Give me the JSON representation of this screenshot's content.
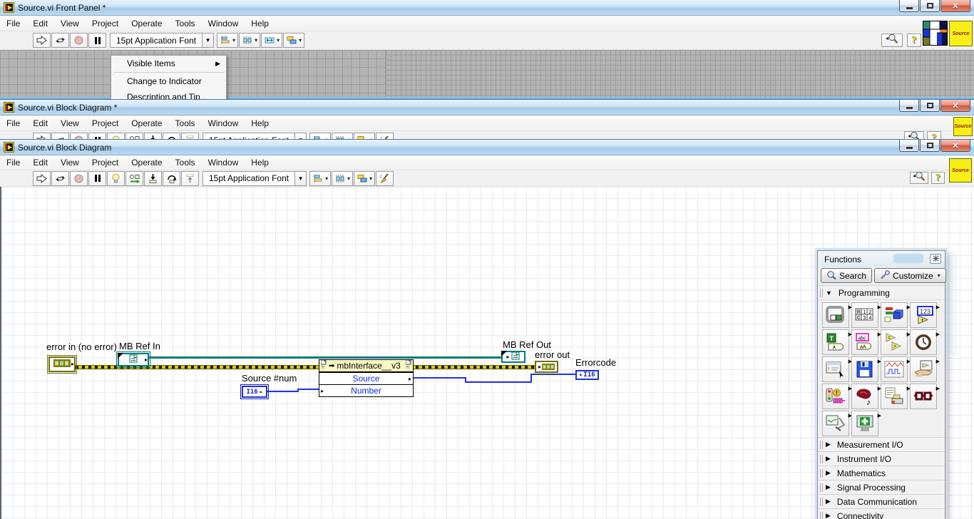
{
  "window_front_panel": {
    "title": "Source.vi Front Panel *"
  },
  "window_block_diagram_back": {
    "title": "Source.vi Block Diagram *"
  },
  "window_block_diagram": {
    "title": "Source.vi Block Diagram"
  },
  "menu_items": [
    "File",
    "Edit",
    "View",
    "Project",
    "Operate",
    "Tools",
    "Window",
    "Help"
  ],
  "font_selector": "15pt Application Font",
  "vi_badge": "Source",
  "glyphs": {
    "help_mark": "?"
  },
  "context_menu": {
    "items": [
      {
        "label": "Visible Items",
        "submenu": true
      },
      {
        "label": "Change to Indicator",
        "submenu": false
      },
      {
        "label": "Description and Tip...",
        "submenu": false
      }
    ]
  },
  "toolbars": {
    "front_panel_left": [
      {
        "icon": "run"
      },
      {
        "icon": "run-continuous"
      },
      {
        "icon": "abort"
      },
      {
        "icon": "pause"
      }
    ],
    "front_panel_right": [
      {
        "icon": "align-objects",
        "caret": true
      },
      {
        "icon": "distribute-objects",
        "caret": true
      },
      {
        "icon": "resize-objects",
        "caret": true
      },
      {
        "icon": "reorder",
        "caret": true
      }
    ],
    "block_diagram_left": [
      {
        "icon": "run"
      },
      {
        "icon": "run-continuous"
      },
      {
        "icon": "abort"
      },
      {
        "icon": "pause"
      },
      {
        "icon": "highlight-execution"
      },
      {
        "icon": "retain-wire-values"
      },
      {
        "icon": "step-into"
      },
      {
        "icon": "step-over"
      },
      {
        "icon": "step-out"
      }
    ],
    "block_diagram_right": [
      {
        "icon": "align-objects",
        "caret": true
      },
      {
        "icon": "distribute-objects",
        "caret": true
      },
      {
        "icon": "reorder",
        "caret": true
      },
      {
        "icon": "clean-up-diagram"
      }
    ]
  },
  "diagram": {
    "error_in_label": "error in (no error)",
    "mb_ref_in_label": "MB Ref In",
    "source_num_label": "Source #num",
    "mb_ref_out_label": "MB Ref Out",
    "error_out_label": "error out",
    "errorcode_label": "Errorcode",
    "i16_text": "I16",
    "node_title": "mbInterface__v3",
    "node_methods": [
      "Source",
      "Number"
    ]
  },
  "palette": {
    "title": "Functions",
    "search_label": "Search",
    "customize_label": "Customize",
    "open_category": "Programming",
    "icons": [
      "structures",
      "array",
      "cluster-class-variant",
      "numeric",
      "boolean",
      "string",
      "comparison",
      "timing",
      "dialog-user-interface",
      "file-io",
      "waveform",
      "application-control",
      "synchronization",
      "graphics-sound",
      "report-generation",
      "misc-functions",
      "measurement-probe",
      "addons"
    ],
    "icon_texts": {
      "numeric": "123",
      "boolean_true": "T",
      "boolean_and": "∧",
      "string_abc": "abc",
      "string_case": "aA",
      "comparison_eq": "=",
      "comparison_gt": ">",
      "sync_bang": "!",
      "music_note": "♪",
      "array_cells": [
        "1",
        "2",
        "3",
        "4"
      ],
      "array_rowcol": [
        "R",
        "C"
      ]
    },
    "categories": [
      "Measurement I/O",
      "Instrument I/O",
      "Mathematics",
      "Signal Processing",
      "Data Communication",
      "Connectivity"
    ]
  },
  "colors": {
    "titlebar_blue": "#a6cbe8",
    "error_wire_yellow": "#d8c821",
    "refnum_teal": "#057a7a",
    "numeric_blue": "#2233cc",
    "node_header_yellow": "#fcf8c6",
    "front_panel_gray": "#b3b3b3",
    "badge_yellow": "#f8ee18"
  }
}
